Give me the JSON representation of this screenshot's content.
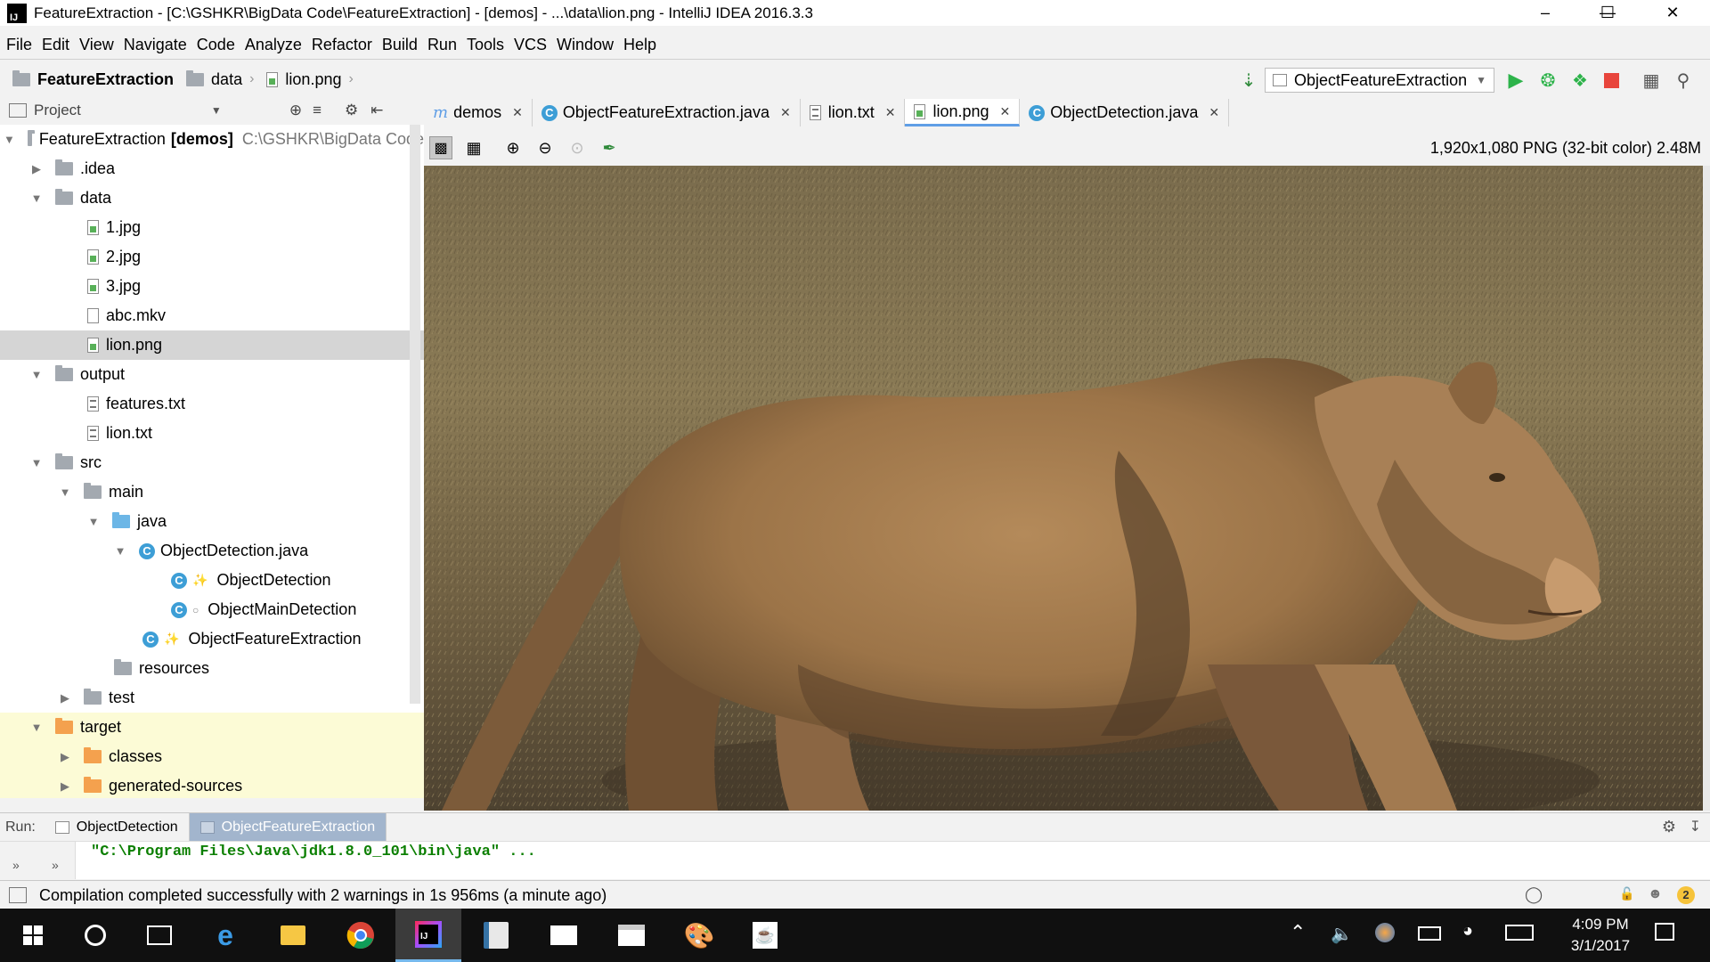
{
  "window": {
    "title": "FeatureExtraction - [C:\\GSHKR\\BigData Code\\FeatureExtraction] - [demos] - ...\\data\\lion.png - IntelliJ IDEA 2016.3.3",
    "logo": "IJ"
  },
  "menu": [
    "File",
    "Edit",
    "View",
    "Navigate",
    "Code",
    "Analyze",
    "Refactor",
    "Build",
    "Run",
    "Tools",
    "VCS",
    "Window",
    "Help"
  ],
  "breadcrumb": [
    "FeatureExtraction",
    "data",
    "lion.png"
  ],
  "run_config": "ObjectFeatureExtraction",
  "project_panel": {
    "title": "Project",
    "root_name": "FeatureExtraction",
    "root_module": "[demos]",
    "root_path": "C:\\GSHKR\\BigData Code",
    "items": [
      {
        "label": ".idea"
      },
      {
        "label": "data"
      },
      {
        "label": "1.jpg"
      },
      {
        "label": "2.jpg"
      },
      {
        "label": "3.jpg"
      },
      {
        "label": "abc.mkv"
      },
      {
        "label": "lion.png"
      },
      {
        "label": "output"
      },
      {
        "label": "features.txt"
      },
      {
        "label": "lion.txt"
      },
      {
        "label": "src"
      },
      {
        "label": "main"
      },
      {
        "label": "java"
      },
      {
        "label": "ObjectDetection.java"
      },
      {
        "label": "ObjectDetection"
      },
      {
        "label": "ObjectMainDetection"
      },
      {
        "label": "ObjectFeatureExtraction"
      },
      {
        "label": "resources"
      },
      {
        "label": "test"
      },
      {
        "label": "target"
      },
      {
        "label": "classes"
      },
      {
        "label": "generated-sources"
      }
    ]
  },
  "tabs": [
    "demos",
    "ObjectFeatureExtraction.java",
    "lion.txt",
    "lion.png",
    "ObjectDetection.java"
  ],
  "image_info": "1,920x1,080 PNG (32-bit color) 2.48M",
  "run_panel": {
    "label": "Run:",
    "tabs": [
      "ObjectDetection",
      "ObjectFeatureExtraction"
    ],
    "command": "\"C:\\Program Files\\Java\\jdk1.8.0_101\\bin\\java\" ...",
    "gutter": "»"
  },
  "status": {
    "message": "Compilation completed successfully with 2 warnings in 1s 956ms (a minute ago)",
    "badge": "2"
  },
  "taskbar": {
    "time": "4:09 PM",
    "date": "3/1/2017"
  },
  "colors": {
    "tab_active_underline": "#5f9ee6",
    "run_green": "#2db34a",
    "stop_red": "#e8453c",
    "console_text": "#0b7f00",
    "excluded_bg": "#fcfbd6",
    "taskbar_bg": "#101010"
  }
}
